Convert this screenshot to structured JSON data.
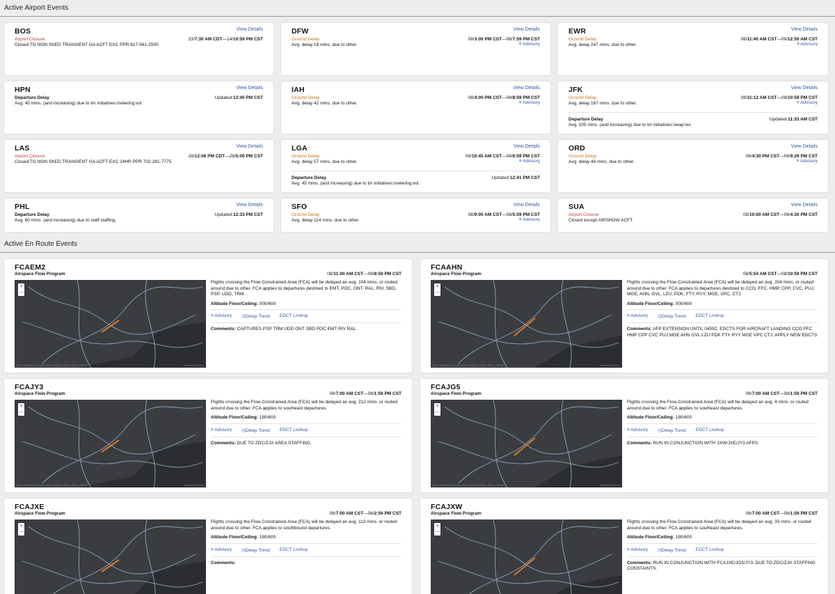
{
  "airport_section": {
    "title": "Active Airport Events"
  },
  "enroute_section": {
    "title": "Active En Route Events"
  },
  "labels": {
    "view_details": "View Details",
    "advisory": "Advisory",
    "altitude_label": "Altitude Floor/Ceiling:",
    "comments_label": "Comments:",
    "delay_trend": "Delay Trend",
    "edct_lookup": "EDCT Lookup",
    "updated": "Updated",
    "map_attribution": "Esri, TomTom, Garmin, FAO, NOAA, USGS, EPA, USFWS",
    "powered_by": "Powered by Esri"
  },
  "airports": [
    {
      "code": "BOS",
      "type": "Airport Closure",
      "type_color": "red",
      "time_a": "23/",
      "time_b": "7:30 AM CDT",
      "time_c": "—14/",
      "time_d": "10:59 PM CST",
      "desc": "Closed TO NON SKED TRANSIENT GA ACFT EXC PPR 617-561-2500"
    },
    {
      "code": "DFW",
      "type": "Ground Delay",
      "type_color": "orange",
      "time_a": "08/",
      "time_b": "3:00 PM CST",
      "time_c": "—08/",
      "time_d": "7:59 PM CST",
      "desc": "Avg. delay 18 mins. due to other.",
      "advisory": true
    },
    {
      "code": "EWR",
      "type": "Ground Delay",
      "type_color": "orange",
      "time_a": "08/",
      "time_b": "11:40 AM CST",
      "time_c": "—09/",
      "time_d": "12:59 AM CST",
      "desc": "Avg. delay 247 mins. due to other.",
      "advisory": true
    },
    {
      "code": "HPN",
      "type": "Departure Delay",
      "type_color": "black",
      "updated": "12:40 PM CST",
      "desc": "Avg. 45 mins. (and increasing) due to tm initiatives:metering:vol."
    },
    {
      "code": "IAH",
      "type": "Ground Delay",
      "type_color": "orange",
      "time_a": "08/",
      "time_b": "4:00 PM CST",
      "time_c": "—08/",
      "time_d": "8:59 PM CST",
      "desc": "Avg. delay 42 mins. due to other.",
      "advisory": true
    },
    {
      "code": "JFK",
      "type": "Ground Delay",
      "type_color": "orange",
      "time_a": "08/",
      "time_b": "11:12 AM CST",
      "time_c": "—08/",
      "time_d": "10:59 PM CST",
      "desc": "Avg. delay 167 mins. due to other.",
      "advisory": true,
      "sub": {
        "type": "Departure Delay",
        "updated": "11:33 AM CST",
        "desc": "Avg. 105 mins. (and increasing) due to tm initiatives:swap:wx."
      }
    },
    {
      "code": "LAS",
      "type": "Airport Closure",
      "type_color": "red",
      "time_a": "28/",
      "time_b": "12:06 PM CDT",
      "time_c": "—28/",
      "time_d": "5:00 PM CST",
      "desc": "Closed TO NON SKED TRANSIENT GA ACFT EXC 24HR PPR 702-261-7775"
    },
    {
      "code": "LGA",
      "type": "Ground Delay",
      "type_color": "orange",
      "time_a": "08/",
      "time_b": "10:45 AM CST",
      "time_c": "—08/",
      "time_d": "6:59 PM CST",
      "desc": "Avg. delay 57 mins. due to other.",
      "advisory": true,
      "sub": {
        "type": "Departure Delay",
        "updated": "12:41 PM CST",
        "desc": "Avg. 45 mins. (and increasing) due to tm initiatives:metering:vol."
      }
    },
    {
      "code": "ORD",
      "type": "Ground Delay",
      "type_color": "orange",
      "time_a": "08/",
      "time_b": "4:30 PM CST",
      "time_c": "—08/",
      "time_d": "9:29 PM CST",
      "desc": "Avg. delay 44 mins. due to other.",
      "advisory": true
    },
    {
      "code": "PHL",
      "type": "Departure Delay",
      "type_color": "black",
      "updated": "12:33 PM CST",
      "desc": "Avg. 60 mins. (and increasing) due to staff:staffing."
    },
    {
      "code": "SFO",
      "type": "Ground Delay",
      "type_color": "orange",
      "time_a": "08/",
      "time_b": "9:00 AM CST",
      "time_c": "—08/",
      "time_d": "5:59 PM CST",
      "desc": "Avg. delay 114 mins. due to other.",
      "advisory": true
    },
    {
      "code": "SUA",
      "type": "Airport Closure",
      "type_color": "red",
      "time_a": "08/",
      "time_b": "10:00 AM CST",
      "time_c": "—08/",
      "time_d": "4:30 PM CST",
      "desc": "Closed except AIRSHOW ACFT"
    }
  ],
  "enroute": [
    {
      "code": "FCAEM2",
      "program": "Airspace Flow Program",
      "time_a": "08/",
      "time_b": "11:00 AM CST",
      "time_c": "—08/",
      "time_d": "8:59 PM CST",
      "desc": "Flights crossing the Flow Constrained Area (FCA) will be delayed an avg. 104 mins. or routed around due to other. FCA applies to departures destined to EMT, POC, ONT, RAL, RIV, SBD, PSP, UDD, TRM.",
      "altitude": "000/600",
      "comments": "CAPTURES PSP TRM UDD ONT SBD POC EMT RIV RAL."
    },
    {
      "code": "FCAAHN",
      "program": "Airspace Flow Program",
      "time_a": "08/",
      "time_b": "5:54 AM CST",
      "time_c": "—08/",
      "time_d": "10:59 PM CST",
      "desc": "Flights crossing the Flow Constrained Area (FCA) will be delayed an avg. 204 mins. or routed around due to other. FCA applies to departures destined to CCO, FFC, HMP, CPP, CVC, PUJ, MGE, AHN, GVL, LZU, PDK, FTY, RYY, MGE, VPC, CTJ.",
      "altitude": "000/600",
      "comments": "AFP EXTENSION UNTIL 0459Z. EDCTS FOR AIRCRAFT LANDING CCO FFC HMP CPP CVC PUJ MGE AHN GVL LZU PDK FTY RYY MGE VPC CTJ. APPLY NEW EDCTS"
    },
    {
      "code": "FCAJY3",
      "program": "Airspace Flow Program",
      "time_a": "08/",
      "time_b": "7:00 AM CST",
      "time_c": "—08/",
      "time_d": "1:59 PM CST",
      "desc": "Flights crossing the Flow Constrained Area (FCA) will be delayed an avg. 212 mins. or routed around due to other. FCA applies to southeast departures.",
      "altitude": "180/600",
      "comments": "DUE TO ZDC/ZJX AREA STAFFING."
    },
    {
      "code": "FCAJG5",
      "program": "Airspace Flow Program",
      "time_a": "08/",
      "time_b": "7:00 AM CST",
      "time_c": "—08/",
      "time_d": "1:59 PM CST",
      "desc": "Flights crossing the Flow Constrained Area (FCA) will be delayed an avg. 4 mins. or routed around due to other. FCA applies to southeast departures.",
      "altitude": "180/600",
      "comments": "RUN IN CONJUNCTION WITH JXW/JXE/JY3 AFPS"
    },
    {
      "code": "FCAJXE",
      "program": "Airspace Flow Program",
      "time_a": "08/",
      "time_b": "7:00 AM CST",
      "time_c": "—08/",
      "time_d": "2:59 PM CST",
      "desc": "Flights crossing the Flow Constrained Area (FCA) will be delayed an avg. 113 mins. or routed around due to other. FCA applies to southbound departures.",
      "altitude": "180/600",
      "comments": ""
    },
    {
      "code": "FCAJXW",
      "program": "Airspace Flow Program",
      "time_a": "08/",
      "time_b": "7:00 AM CST",
      "time_c": "—08/",
      "time_d": "1:59 PM CST",
      "desc": "Flights crossing the Flow Constrained Area (FCA) will be delayed an avg. 33 mins. or routed around due to other. FCA applies to southeast departures.",
      "altitude": "180/600",
      "comments": "RUN IN CONJUNCTION WITH FCAJXE/JG5/JY3. DUE TO ZDC/ZJX STAFFING CONSTAINTS."
    }
  ]
}
